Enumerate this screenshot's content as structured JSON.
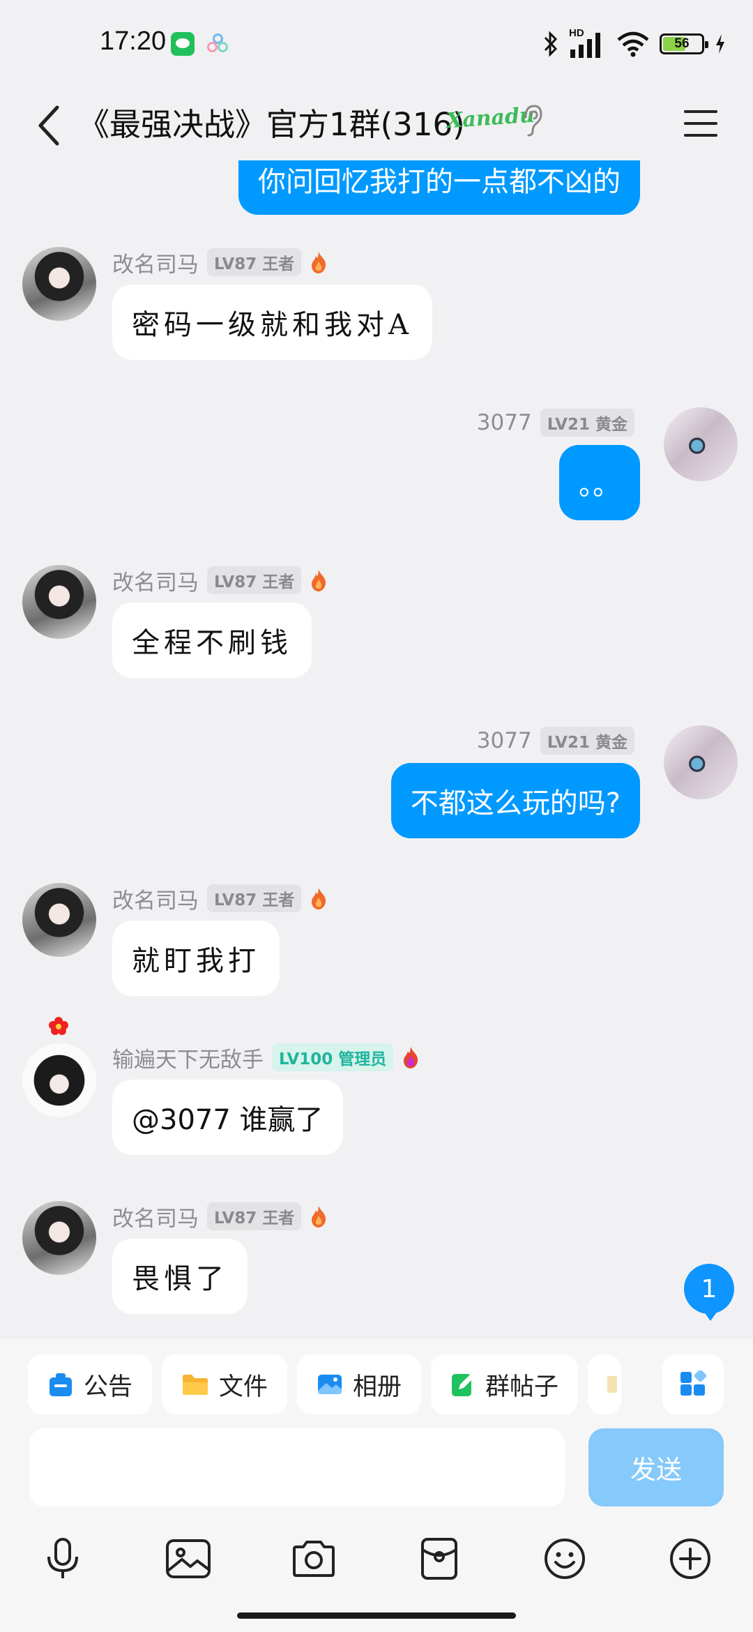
{
  "status_bar": {
    "time": "17:20",
    "battery": "56",
    "network": "HD"
  },
  "header": {
    "title": "《最强决战》官方1群(316)",
    "logo_text": "Xanadu"
  },
  "messages": [
    {
      "side": "right",
      "text": "你问回忆我打的一点都不凶的"
    },
    {
      "side": "left",
      "name": "改名司马",
      "level": "LV87 王者",
      "text": "密码一级就和我对A"
    },
    {
      "side": "right",
      "name": "3077",
      "level": "LV21 黄金",
      "text": "。。"
    },
    {
      "side": "left",
      "name": "改名司马",
      "level": "LV87 王者",
      "text": "全程不刷钱"
    },
    {
      "side": "right",
      "name": "3077",
      "level": "LV21 黄金",
      "text": "不都这么玩的吗?"
    },
    {
      "side": "left",
      "name": "改名司马",
      "level": "LV87 王者",
      "text": "就盯我打"
    },
    {
      "side": "left",
      "name": "输遍天下无敌手",
      "level": "LV100 管理员",
      "text": "@3077 谁赢了"
    },
    {
      "side": "left",
      "name": "改名司马",
      "level": "LV87 王者",
      "text": "畏惧了"
    }
  ],
  "unread_count": "1",
  "shortcuts": [
    {
      "label": "公告",
      "icon": "announcement-icon",
      "color": "#1a8cf0"
    },
    {
      "label": "文件",
      "icon": "folder-icon",
      "color": "#f6b42f"
    },
    {
      "label": "相册",
      "icon": "album-icon",
      "color": "#1a8cf0"
    },
    {
      "label": "群帖子",
      "icon": "post-icon",
      "color": "#1fc25e"
    }
  ],
  "input": {
    "placeholder": "",
    "send_label": "发送"
  },
  "toolbar": [
    "microphone-icon",
    "image-icon",
    "camera-icon",
    "red-packet-icon",
    "emoji-icon",
    "plus-icon"
  ]
}
